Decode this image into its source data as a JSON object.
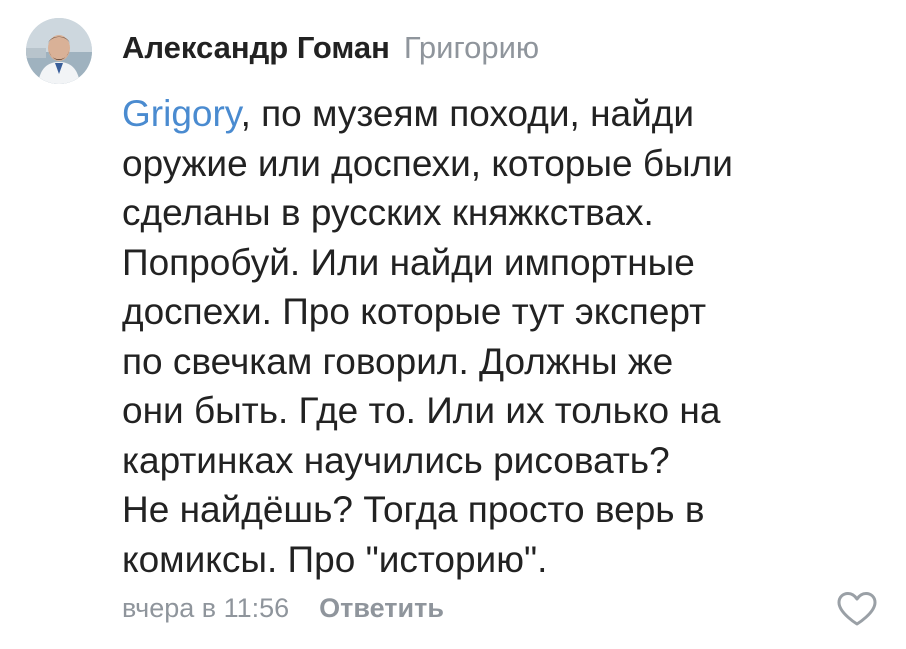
{
  "comment": {
    "author": "Александр Гоман",
    "reply_to": "Григорию",
    "mention": "Grigory",
    "text_lines": [
      ", по музеям походи, найди",
      "оружие или доспехи, которые были",
      "сделаны в русских княжкствах.",
      "Попробуй. Или найди импортные",
      "доспехи. Про которые тут эксперт",
      "по свечкам говорил. Должны же",
      "они быть. Где то. Или их только на",
      "картинках научились рисовать?",
      "Не найдёшь? Тогда просто верь в",
      "комиксы. Про \"историю\"."
    ],
    "timestamp": "вчера в 11:56",
    "reply_label": "Ответить",
    "like_icon": "heart-outline-icon"
  },
  "colors": {
    "text": "#222222",
    "muted": "#8f959c",
    "link": "#4a8bd0"
  }
}
